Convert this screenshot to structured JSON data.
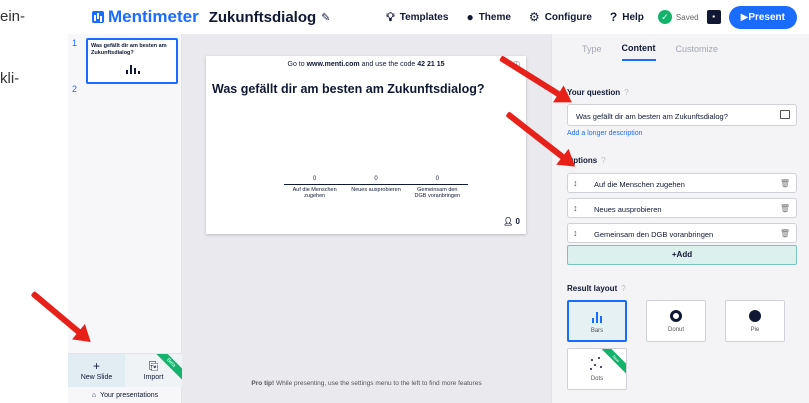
{
  "document_fragment": {
    "line1": "ein-",
    "line2": "kli-"
  },
  "brand": {
    "name": "Mentimeter",
    "color": "#196cff"
  },
  "presentation_title": "Zukunftsdialog",
  "nav": {
    "templates": "Templates",
    "theme": "Theme",
    "configure": "Configure",
    "help": "Help",
    "saved": "Saved",
    "present": "Present"
  },
  "sidebar": {
    "slides": [
      {
        "number": "1",
        "title": "Was gefällt dir am besten am Zukunftsdialog?"
      }
    ],
    "slide2_number": "2",
    "new_slide": "New Slide",
    "import": "Import",
    "import_badge": "Beta",
    "your_presentations": "Your presentations"
  },
  "slide": {
    "goto_prefix": "Go to",
    "goto_url": "www.menti.com",
    "goto_middle": "and use the code",
    "code": "42 21 15",
    "question": "Was gefällt dir am besten am Zukunftsdialog?",
    "audience_count": "0"
  },
  "chart_data": {
    "type": "bar",
    "categories": [
      "Auf die Menschen zugehen",
      "Neues ausprobieren",
      "Gemeinsam den DGB voranbringen"
    ],
    "values": [
      0,
      0,
      0
    ]
  },
  "canvas": {
    "protip_label": "Pro tip!",
    "protip_text": "While presenting, use the settings menu to the left to find more features"
  },
  "panel": {
    "tabs": [
      {
        "label": "Type"
      },
      {
        "label": "Content"
      },
      {
        "label": "Customize"
      }
    ],
    "active_tab": "Content",
    "your_question_label": "Your question",
    "question_value": "Was gefällt dir am besten am Zukunftsdialog?",
    "longer_description": "Add a longer description",
    "options_label": "Options",
    "options": [
      {
        "label": "Auf die Menschen zugehen"
      },
      {
        "label": "Neues ausprobieren"
      },
      {
        "label": "Gemeinsam den DGB voranbringen"
      }
    ],
    "add_label": "Add",
    "result_layout_label": "Result layout",
    "layouts": [
      {
        "name": "Bars",
        "selected": true
      },
      {
        "name": "Donut",
        "selected": false
      },
      {
        "name": "Pie",
        "selected": false
      },
      {
        "name": "Dots",
        "selected": false,
        "badge": "New"
      }
    ]
  }
}
